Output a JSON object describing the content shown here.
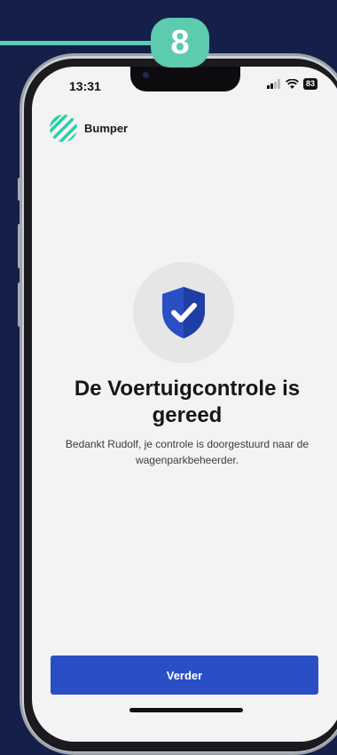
{
  "step_badge": "8",
  "status_bar": {
    "time": "13:31",
    "battery": "83"
  },
  "app": {
    "brand_name": "Bumper"
  },
  "confirmation": {
    "title": "De Voertuigcontrole is gereed",
    "message": "Bedankt Rudolf, je controle is doorgestuurd naar de wagenparkbeheerder."
  },
  "actions": {
    "continue_label": "Verder"
  },
  "colors": {
    "background": "#14204a",
    "accent_teal": "#5ccbb0",
    "primary_button": "#2a4fc4",
    "shield": "#2a4fc4"
  }
}
